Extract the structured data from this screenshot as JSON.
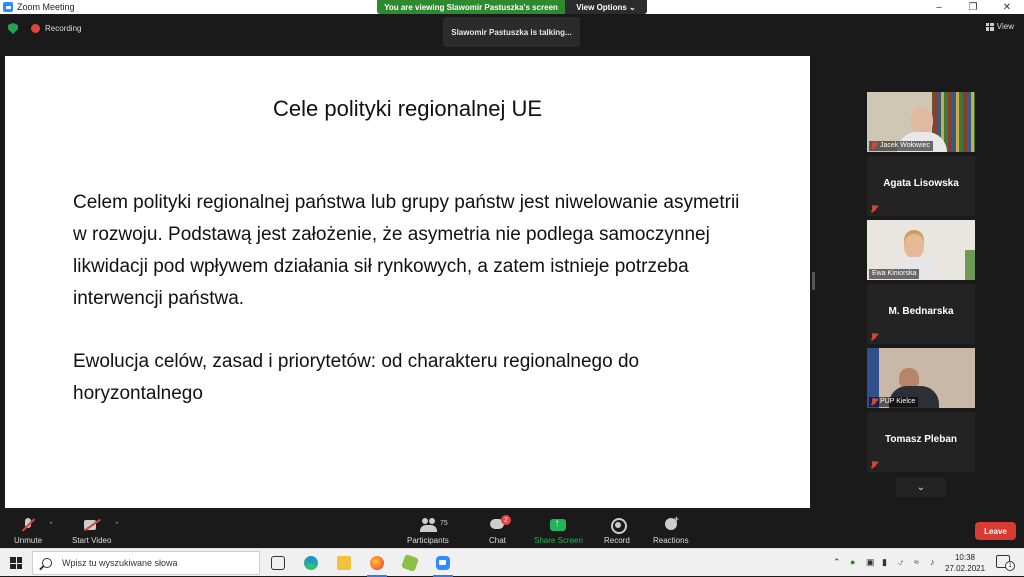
{
  "window": {
    "title": "Zoom Meeting"
  },
  "share_banner": {
    "text": "You are viewing Slawomir Pastuszka's screen",
    "view_options": "View Options ⌄"
  },
  "meeting": {
    "recording_label": "Recording",
    "talking": "Slawomir Pastuszka is talking...",
    "view_label": "View"
  },
  "slide": {
    "title": "Cele polityki regionalnej UE",
    "paragraph1": "Celem polityki regionalnej państwa lub grupy państw jest niwelowanie asymetrii w rozwoju. Podstawą jest założenie, że asymetria nie podlega samoczynnej likwidacji pod wpływem działania sił rynkowych, a zatem istnieje potrzeba interwencji państwa.",
    "paragraph2": "Ewolucja celów, zasad i priorytetów: od charakteru regionalnego do horyzontalnego"
  },
  "participants": [
    {
      "name": "Jacek Wołowiec",
      "video": true
    },
    {
      "name": "Agata Lisowska",
      "video": false
    },
    {
      "name": "Ewa Kiniorska",
      "video": true
    },
    {
      "name": "M. Bednarska",
      "video": false
    },
    {
      "name": "PUP Kielce",
      "video": true
    },
    {
      "name": "Tomasz Pleban",
      "video": false
    }
  ],
  "toolbar": {
    "unmute": "Unmute",
    "start_video": "Start Video",
    "participants": "Participants",
    "participants_count": "75",
    "chat": "Chat",
    "chat_badge": "2",
    "share_screen": "Share Screen",
    "record": "Record",
    "reactions": "Reactions",
    "leave": "Leave"
  },
  "taskbar": {
    "search_placeholder": "Wpisz tu wyszukiwane słowa",
    "time": "10:38",
    "date": "27.02.2021",
    "notification_count": "1"
  },
  "colors": {
    "accent_green": "#23b35a",
    "leave_red": "#d93a32",
    "banner_green": "#2f8a2f",
    "zoom_blue": "#2d8cff"
  }
}
